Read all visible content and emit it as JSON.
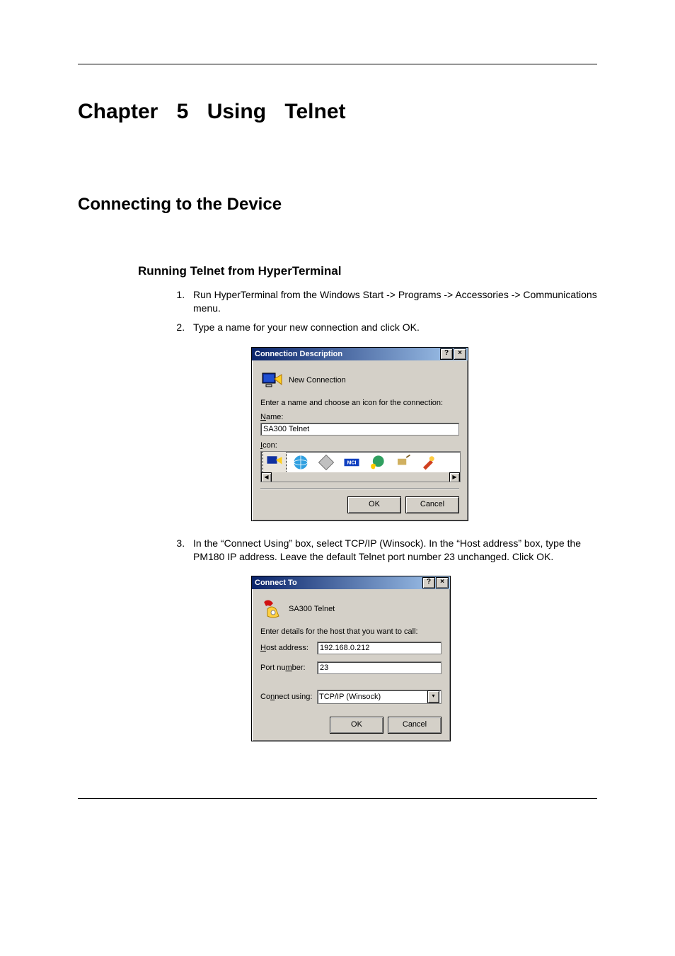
{
  "chapterTitle": "Chapter 5 Using Telnet",
  "sectionTitle": "Connecting to the Device",
  "subsectionTitle": "Running Telnet from HyperTerminal",
  "steps": {
    "1": "Run HyperTerminal from the Windows Start -> Programs -> Accessories -> Communications menu.",
    "2": "Type a name for your new connection and click OK.",
    "3": "In the “Connect Using” box, select TCP/IP (Winsock). In the “Host address” box, type the PM180 IP address. Leave the default Telnet port number 23 unchanged. Click OK."
  },
  "dialog1": {
    "title": "Connection Description",
    "helpGlyph": "?",
    "closeGlyph": "×",
    "heading": "New Connection",
    "prompt": "Enter a name and choose an icon for the connection:",
    "nameLabelU": "N",
    "nameLabelRest": "ame:",
    "nameValue": "SA300 Telnet",
    "iconLabelU": "I",
    "iconLabelRest": "con:",
    "scrollLeft": "◀",
    "scrollRight": "▶",
    "okLabel": "OK",
    "cancelLabel": "Cancel",
    "iconNames": [
      "ht-icon",
      "globe-icon",
      "diamond-icon",
      "mci-icon",
      "phone-globe-icon",
      "satellite-icon",
      "tools-icon"
    ]
  },
  "dialog2": {
    "title": "Connect To",
    "helpGlyph": "?",
    "closeGlyph": "×",
    "heading": "SA300 Telnet",
    "prompt": "Enter details for the host that you want to call:",
    "hostLabelU": "H",
    "hostLabelRest": "ost address:",
    "hostValue": "192.168.0.212",
    "portLabelPre": "Port nu",
    "portLabelU": "m",
    "portLabelPost": "ber:",
    "portValue": "23",
    "connectLabelPre": "Co",
    "connectLabelU": "n",
    "connectLabelPost": "nect using:",
    "connectValue": "TCP/IP (Winsock)",
    "dropdownGlyph": "▾",
    "okLabel": "OK",
    "cancelLabel": "Cancel"
  }
}
